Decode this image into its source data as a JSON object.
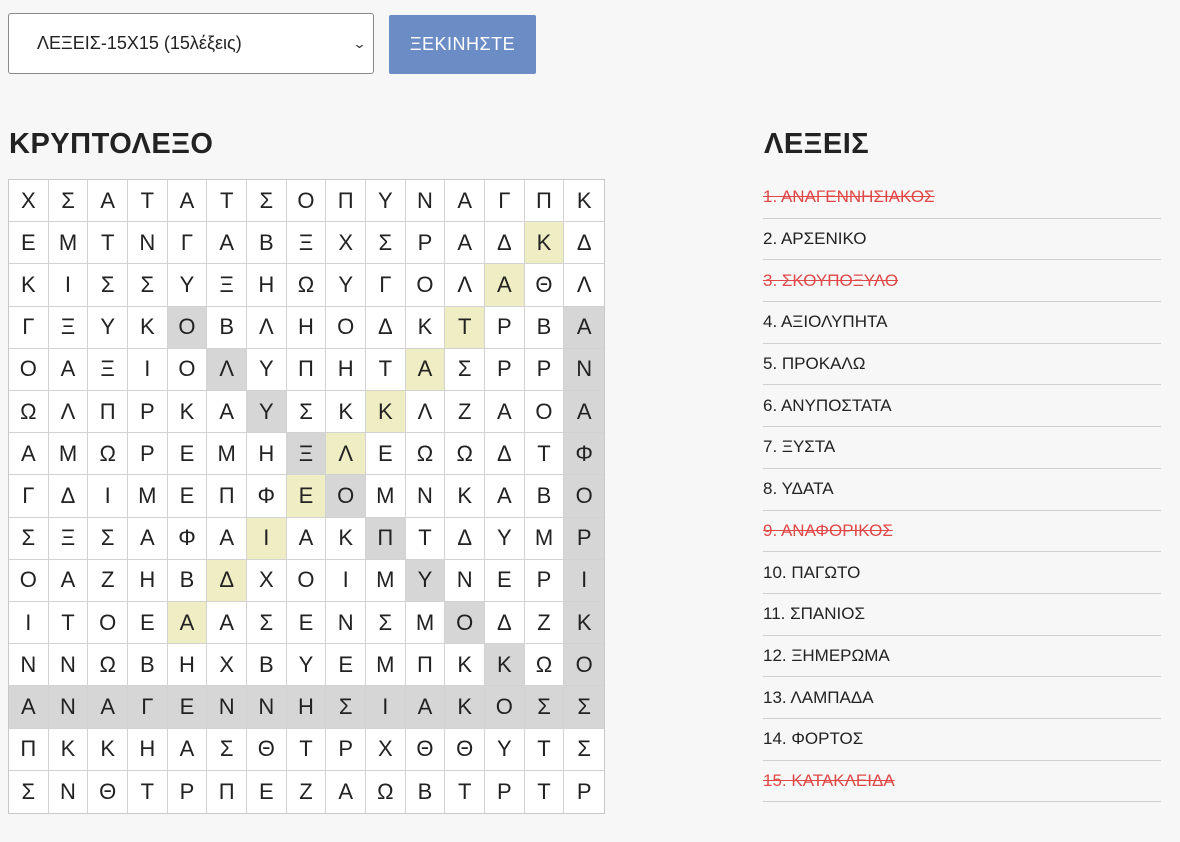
{
  "controls": {
    "puzzle_select": "ΛΕΞΕΙΣ-15Χ15 (15λέξεις)",
    "start_label": "ΞΕΚΙΝΗΣΤΕ"
  },
  "puzzle": {
    "title": "ΚΡΥΠΤΟΛΕΞΟ",
    "rows": [
      "ΧΣΑΤΑΤΣΟΠΥΝΑΓΠΚ",
      "ΕΜΤΝΓΑΒΞΧΣΡΑΔΚΔ",
      "ΚΙΣΣΥΞΗΩΥΓΟΛΑΘΛ",
      "ΓΞΥΚΟΒΛΗΟΔΚΤΡΒΑ",
      "ΟΑΞΙΟΛΥΠΗΤΑΣΡΡΝ",
      "ΩΛΠΡΚΑΥΣΚΚΛΖΑΟΑ",
      "ΑΜΩΡΕΜΗΞΛΕΩΩΔΤΦ",
      "ΓΔΙΜΕΠΦΕΟΜΝΚΑΒΟ",
      "ΣΞΣΑΦΑΙΑΚΠΤΔΥΜΡ",
      "ΟΑΖΗΒΔΧΟΙΜΥΝΕΡΙ",
      "ΙΤΟΕΑΑΣΕΝΣΜΟΔΖΚ",
      "ΝΝΩΒΗΧΒΥΕΜΠΚΚΩΟ",
      "ΑΝΑΓΕΝΝΗΣΙΑΚΟΣΣ",
      "ΠΚΚΗΑΣΘΤΡΧΘΘΥΤΣ",
      "ΣΝΘΤΡΠΕΖΑΩΒΤΡΤΡ"
    ],
    "highlight_colors": {
      "gray": "#d6d6d6",
      "yellow": "#efedc3"
    },
    "gray_cells": [
      [
        3,
        4
      ],
      [
        4,
        5
      ],
      [
        5,
        6
      ],
      [
        6,
        7
      ],
      [
        7,
        8
      ],
      [
        8,
        9
      ],
      [
        9,
        10
      ],
      [
        10,
        11
      ],
      [
        11,
        12
      ],
      [
        3,
        14
      ],
      [
        4,
        14
      ],
      [
        5,
        14
      ],
      [
        6,
        14
      ],
      [
        7,
        14
      ],
      [
        8,
        14
      ],
      [
        9,
        14
      ],
      [
        10,
        14
      ],
      [
        11,
        14
      ],
      [
        12,
        0
      ],
      [
        12,
        1
      ],
      [
        12,
        2
      ],
      [
        12,
        3
      ],
      [
        12,
        4
      ],
      [
        12,
        5
      ],
      [
        12,
        6
      ],
      [
        12,
        7
      ],
      [
        12,
        8
      ],
      [
        12,
        9
      ],
      [
        12,
        10
      ],
      [
        12,
        11
      ],
      [
        12,
        12
      ],
      [
        12,
        13
      ],
      [
        12,
        14
      ]
    ],
    "yellow_cells": [
      [
        1,
        13
      ],
      [
        2,
        12
      ],
      [
        3,
        11
      ],
      [
        4,
        10
      ],
      [
        5,
        9
      ],
      [
        6,
        8
      ],
      [
        7,
        7
      ],
      [
        8,
        6
      ],
      [
        9,
        5
      ],
      [
        10,
        4
      ]
    ]
  },
  "words": {
    "title": "ΛΕΞΕΙΣ",
    "found_color": "#e04848",
    "items": [
      {
        "label": "1. ΑΝΑΓΕΝΝΗΣΙΑΚΟΣ",
        "found": true
      },
      {
        "label": "2. ΑΡΣΕΝΙΚΟ",
        "found": false
      },
      {
        "label": "3. ΣΚΟΥΠΟΞΥΛΟ",
        "found": true
      },
      {
        "label": "4. ΑΞΙΟΛΥΠΗΤΑ",
        "found": false
      },
      {
        "label": "5. ΠΡΟΚΑΛΩ",
        "found": false
      },
      {
        "label": "6. ΑΝΥΠΟΣΤΑΤΑ",
        "found": false
      },
      {
        "label": "7. ΞΥΣΤΑ",
        "found": false
      },
      {
        "label": "8. ΥΔΑΤΑ",
        "found": false
      },
      {
        "label": "9. ΑΝΑΦΟΡΙΚΟΣ",
        "found": true
      },
      {
        "label": "10. ΠΑΓΩΤΟ",
        "found": false
      },
      {
        "label": "11. ΣΠΑΝΙΟΣ",
        "found": false
      },
      {
        "label": "12. ΞΗΜΕΡΩΜΑ",
        "found": false
      },
      {
        "label": "13. ΛΑΜΠΑΔΑ",
        "found": false
      },
      {
        "label": "14. ΦΟΡΤΟΣ",
        "found": false
      },
      {
        "label": "15. ΚΑΤΑΚΛΕΙΔΑ",
        "found": true
      }
    ]
  }
}
